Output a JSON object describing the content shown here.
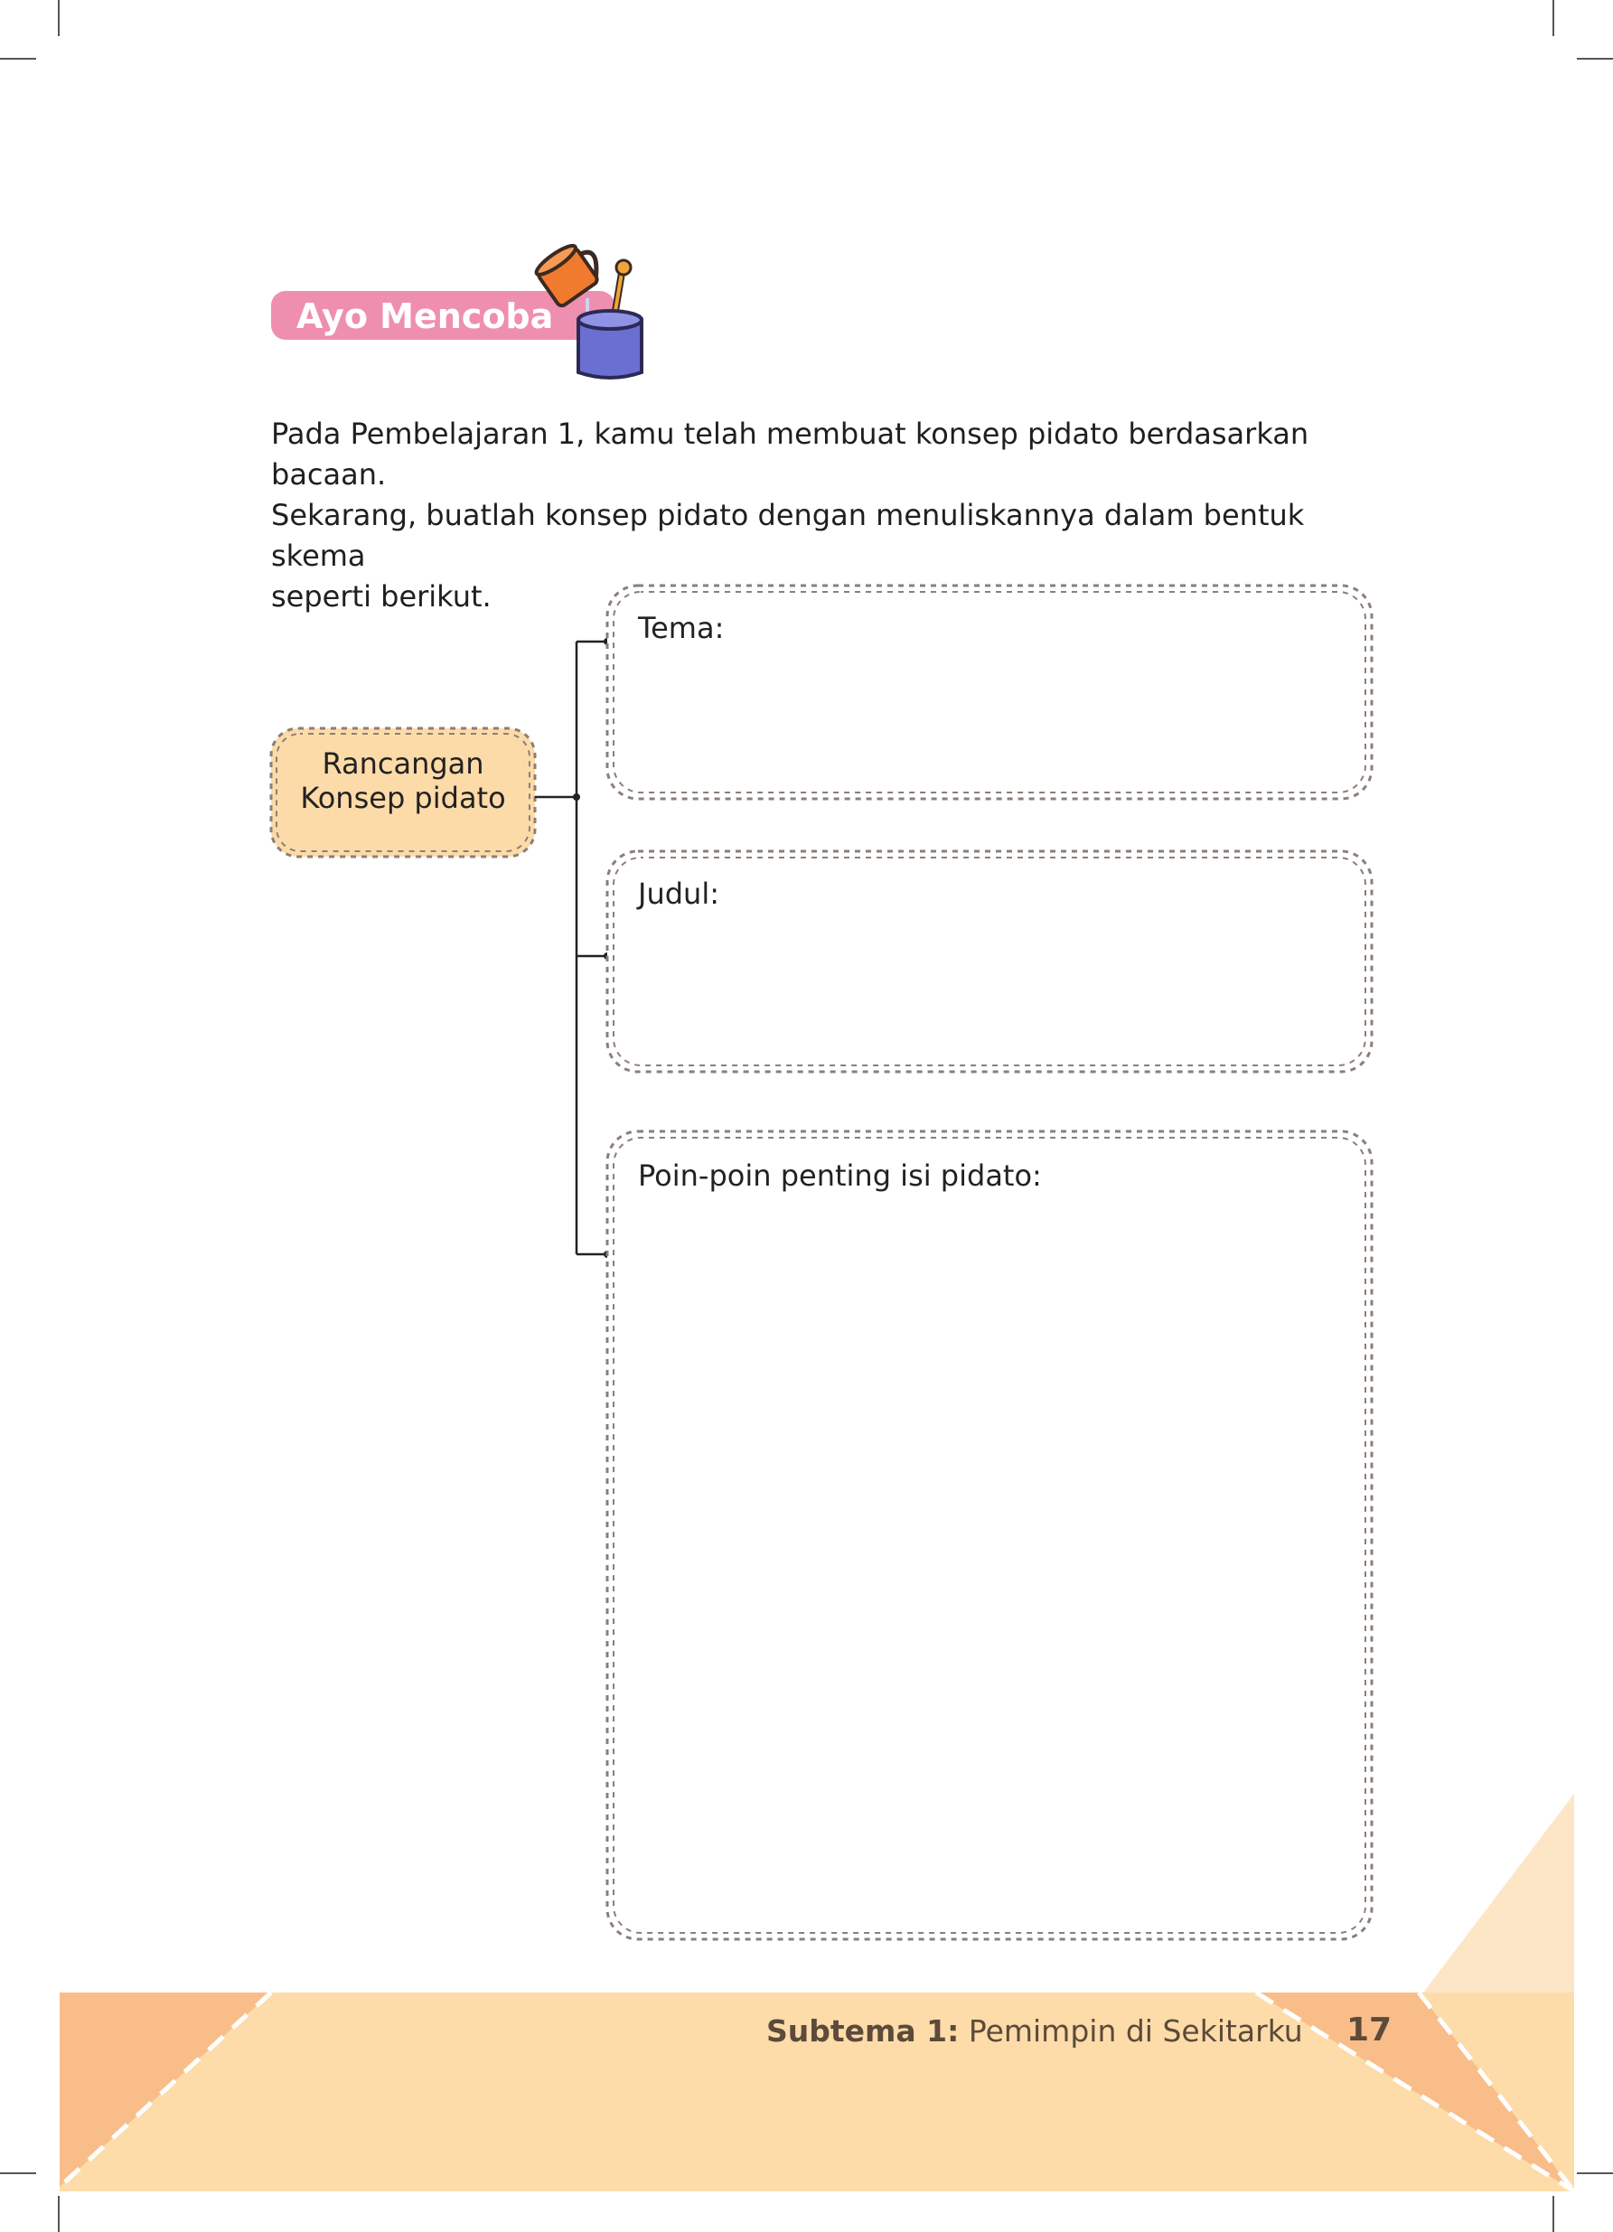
{
  "section": {
    "badge_label": "Ayo Mencoba",
    "icon": "pouring-mug-icon"
  },
  "intro": {
    "lines": [
      "Pada Pembelajaran 1, kamu telah membuat konsep pidato berdasarkan bacaan.",
      "Sekarang, buatlah konsep pidato dengan menuliskannya dalam bentuk skema",
      "seperti berikut."
    ]
  },
  "diagram": {
    "root_lines": [
      "Rancangan",
      "Konsep pidato"
    ],
    "boxes": [
      {
        "label": "Tema:"
      },
      {
        "label": "Judul:"
      },
      {
        "label": "Poin-poin penting isi pidato:"
      }
    ]
  },
  "footer": {
    "subtema_label": "Subtema 1:",
    "subtema_title": "Pemimpin di Sekitarku",
    "page_number": "17"
  },
  "colors": {
    "badge": "#ef8fb0",
    "root_fill": "#fddba8",
    "footer_light": "#fddcaa",
    "footer_dark": "#f9bd8a",
    "frame": "#8a7f7a"
  }
}
